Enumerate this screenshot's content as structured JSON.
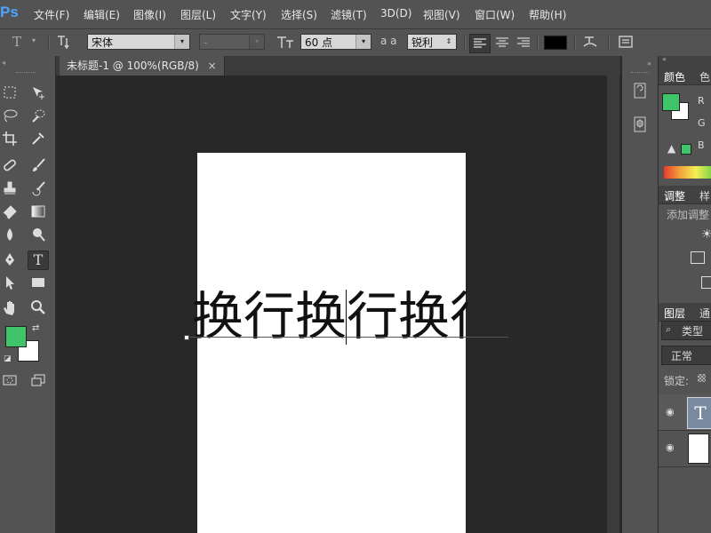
{
  "app": {
    "logo": "Ps"
  },
  "menu": [
    "文件(F)",
    "编辑(E)",
    "图像(I)",
    "图层(L)",
    "文字(Y)",
    "选择(S)",
    "滤镜(T)",
    "3D(D)",
    "视图(V)",
    "窗口(W)",
    "帮助(H)"
  ],
  "options": {
    "font_family": "宋体",
    "font_style": "-",
    "font_size": "60 点",
    "aa_label": "a a",
    "antialias": "锐利",
    "text_color": "#000000"
  },
  "document": {
    "tab_title": "未标题-1 @ 100%(RGB/8)",
    "close": "×",
    "canvas_text": "换行换行换行"
  },
  "colors": {
    "foreground": "#3fc46a",
    "background": "#ffffff"
  },
  "panels": {
    "color_tab": "颜色",
    "swatch_tab": "色",
    "r_label": "R",
    "g_label": "G",
    "b_label": "B",
    "adjust_tab": "调整",
    "style_tab": "样",
    "add_adjust": "添加调整",
    "layers_tab": "图层",
    "channels_tab": "通",
    "filter_kind": "类型",
    "blend_mode": "正常",
    "lock_label": "锁定:"
  },
  "icons": {
    "caret": "▾",
    "text_tool": "T",
    "eye": "◉"
  }
}
